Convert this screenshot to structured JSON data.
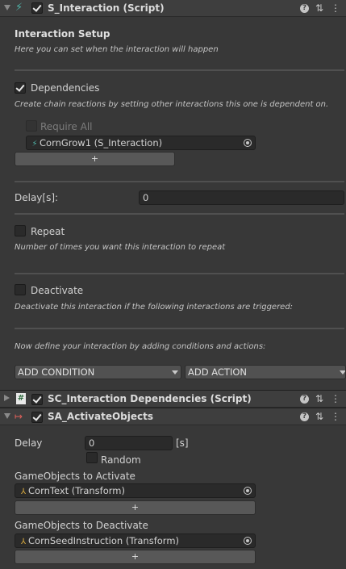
{
  "colors": {
    "background": "#383838",
    "header": "#3e3e3e",
    "field": "#2a2a2a",
    "button": "#585858",
    "interaction_icon": "#4fb3a8",
    "activate_icon": "#e0605a",
    "tf_icon": "#e0b040"
  },
  "components": {
    "s_interaction": {
      "title": "S_Interaction (Script)",
      "icon": "interaction-script-icon",
      "enabled": true,
      "setup_title": "Interaction Setup",
      "setup_desc": "Here you can set when the interaction will happen",
      "dependencies": {
        "label": "Dependencies",
        "checked": true,
        "desc": "Create chain reactions by setting other interactions this one is dependent on.",
        "require_all": "Require All",
        "item": "CornGrow1 (S_Interaction)",
        "add": "+"
      },
      "delay": {
        "label": "Delay[s]:",
        "value": "0"
      },
      "repeat": {
        "label": "Repeat",
        "checked": false,
        "desc": "Number of times you want this interaction to repeat"
      },
      "deactivate": {
        "label": "Deactivate",
        "checked": false,
        "desc": "Deactivate this interaction if the following interactions are triggered:"
      },
      "define_text": "Now define your interaction by adding conditions and actions:",
      "add_condition": "ADD CONDITION",
      "add_action": "ADD ACTION"
    },
    "sc_dependencies": {
      "title": "SC_Interaction Dependencies (Script)",
      "icon": "csharp-script-icon",
      "enabled": true
    },
    "sa_activate": {
      "title": "SA_ActivateObjects",
      "icon": "activate-objects-icon",
      "enabled": true,
      "delay_label": "Delay",
      "delay_value": "0",
      "delay_unit": "[s]",
      "random_label": "Random",
      "activate_label": "GameObjects to Activate",
      "activate_item": "CornText (Transform)",
      "deactivate_label": "GameObjects to Deactivate",
      "deactivate_item": "CornSeedInstruction (Transform)",
      "add": "+"
    }
  },
  "header_icons": {
    "help": "?",
    "settings": "⇅",
    "menu": "⋮"
  }
}
